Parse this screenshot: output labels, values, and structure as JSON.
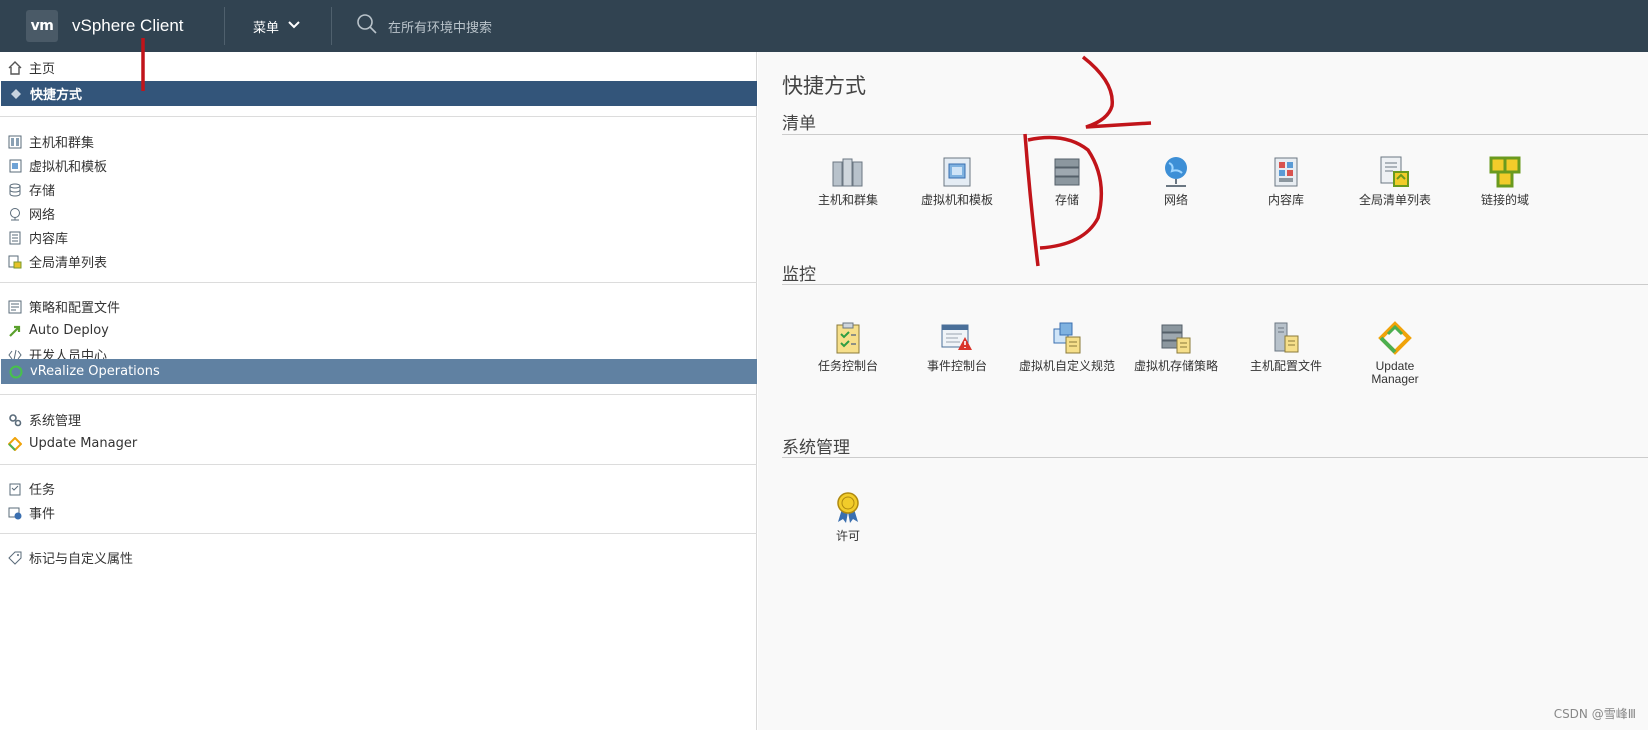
{
  "header": {
    "logo_text": "vm",
    "app_title": "vSphere Client",
    "menu_label": "菜单",
    "search_placeholder": "在所有环境中搜索"
  },
  "sidebar": {
    "home": "主页",
    "shortcuts": "快捷方式",
    "hosts_clusters": "主机和群集",
    "vms_templates": "虚拟机和模板",
    "storage": "存储",
    "network": "网络",
    "content_library": "内容库",
    "global_inventory": "全局清单列表",
    "policies_profiles": "策略和配置文件",
    "auto_deploy": "Auto Deploy",
    "developer_center": "开发人员中心",
    "vrealize": "vRealize Operations",
    "administration": "系统管理",
    "update_manager": "Update Manager",
    "tasks": "任务",
    "events": "事件",
    "tags_attributes": "标记与自定义属性"
  },
  "main": {
    "page_title": "快捷方式",
    "inventory": {
      "title": "清单",
      "tiles": [
        "主机和群集",
        "虚拟机和模板",
        "存储",
        "网络",
        "内容库",
        "全局清单列表",
        "链接的域"
      ]
    },
    "monitoring": {
      "title": "监控",
      "tiles": [
        "任务控制台",
        "事件控制台",
        "虚拟机自定义规范",
        "虚拟机存储策略",
        "主机配置文件",
        "Update Manager"
      ]
    },
    "administration": {
      "title": "系统管理",
      "tiles": [
        "许可"
      ]
    }
  },
  "watermark": "CSDN @雪峰Ⅲ",
  "colors": {
    "topbar": "#314351",
    "sidebar_active": "#33557a",
    "sidebar_active_secondary": "#6081a2",
    "annotation": "#c1141a"
  }
}
